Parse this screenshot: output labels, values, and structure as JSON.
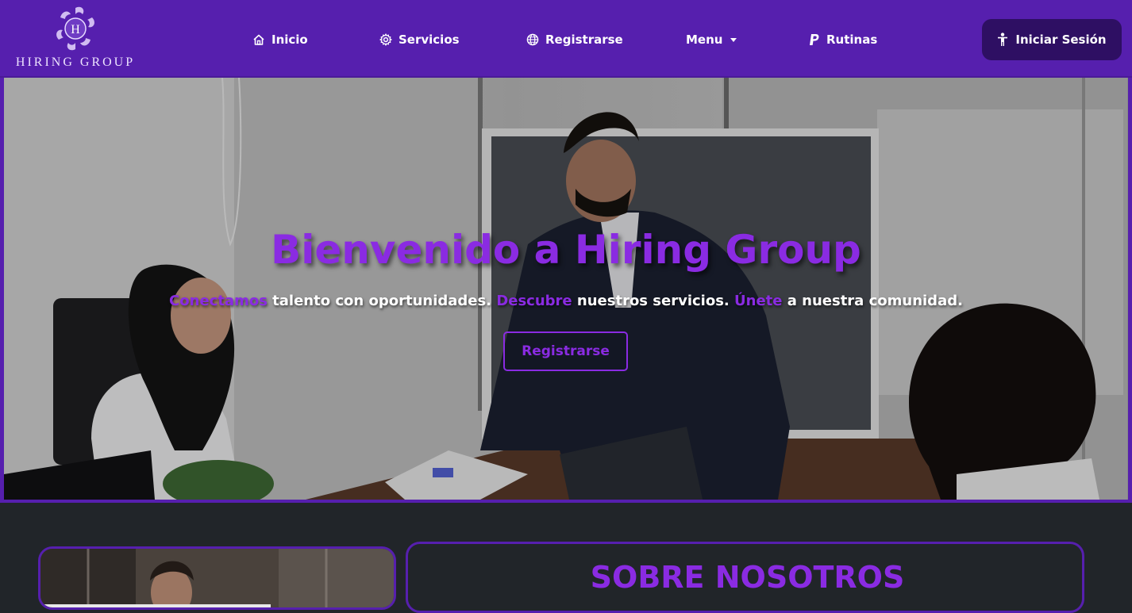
{
  "brand": {
    "name": "HIRING GROUP",
    "logo_letter": "H"
  },
  "nav": {
    "items": [
      {
        "label": "Inicio",
        "icon": "home-icon"
      },
      {
        "label": "Servicios",
        "icon": "gear-icon"
      },
      {
        "label": "Registrarse",
        "icon": "globe-icon"
      },
      {
        "label": "Menu",
        "icon": "chevron-down-icon"
      },
      {
        "label": "Rutinas",
        "icon": "paypal-icon"
      }
    ],
    "login_label": "Iniciar Sesión",
    "login_icon": "person-icon"
  },
  "hero": {
    "title": "Bienvenido a Hiring Group",
    "subtitle": {
      "w1": "Conectamos",
      "t1": " talento con oportunidades. ",
      "w2": "Descubre",
      "t2": " nuestros servicios. ",
      "w3": "Únete",
      "t3": " a nuestra comunidad."
    },
    "button_label": "Registrarse"
  },
  "about": {
    "title": "SOBRE NOSOTROS"
  },
  "colors": {
    "navbar": "#561fae",
    "accent": "#8a2be2",
    "login_button": "#2e0f63",
    "page_background": "#212529"
  }
}
